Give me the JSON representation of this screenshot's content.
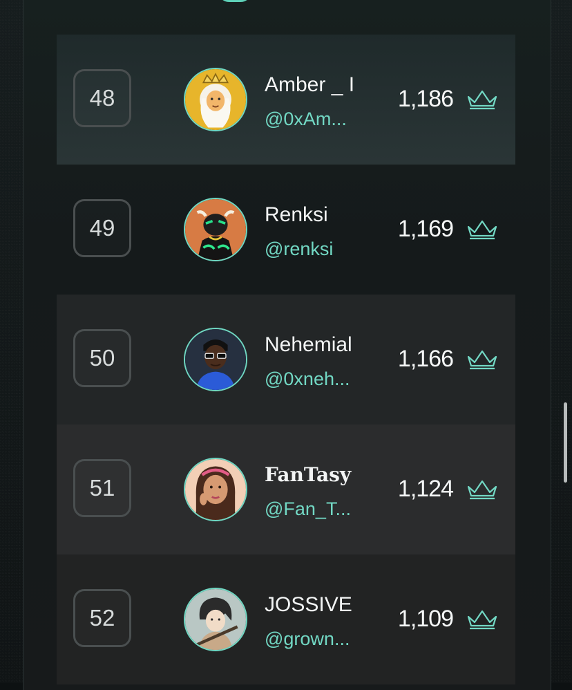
{
  "leaderboard": {
    "rows": [
      {
        "rank": "48",
        "name": "Amber _ I",
        "handle": "@0xAm...",
        "score": "1,186",
        "avatar": "lion-king-avatar",
        "crown_icon": "crown-icon"
      },
      {
        "rank": "49",
        "name": "Renksi",
        "handle": "@renksi",
        "score": "1,169",
        "avatar": "bull-avatar",
        "crown_icon": "crown-icon"
      },
      {
        "rank": "50",
        "name": "Nehemial",
        "handle": "@0xneh...",
        "score": "1,166",
        "avatar": "sunglasses-man-avatar",
        "crown_icon": "crown-icon"
      },
      {
        "rank": "51",
        "name": "FanTasy",
        "handle": "@Fan_T...",
        "score": "1,124",
        "avatar": "woman-headband-avatar",
        "crown_icon": "crown-icon"
      },
      {
        "rank": "52",
        "name": "JOSSIVE",
        "handle": "@grown...",
        "score": "1,109",
        "avatar": "anime-warrior-avatar",
        "crown_icon": "crown-icon"
      }
    ]
  },
  "colors": {
    "accent": "#72d8c4",
    "text": "#f2f4f4",
    "background": "#0d1112"
  }
}
